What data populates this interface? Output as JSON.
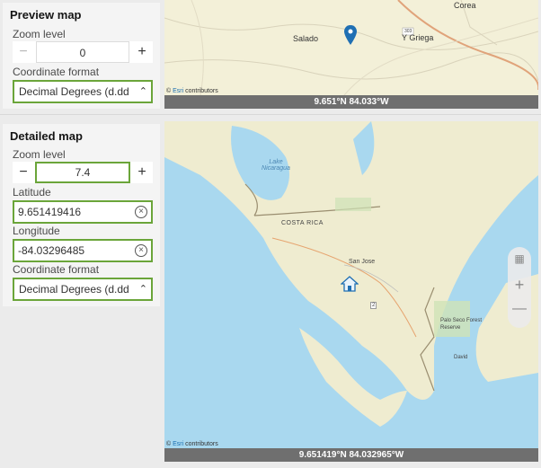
{
  "preview": {
    "title": "Preview map",
    "zoom_label": "Zoom level",
    "zoom_value": "0",
    "minus": "−",
    "plus": "+",
    "format_label": "Coordinate format",
    "format_value": "Decimal Degrees (d.dd",
    "coords": "9.651°N 84.033°W",
    "places": [
      "Corea",
      "Salado",
      "Y Griega",
      "303"
    ],
    "attribution_prefix": "©",
    "attribution_link": "Esri",
    "attribution_suffix": "contributors"
  },
  "detailed": {
    "title": "Detailed map",
    "zoom_label": "Zoom level",
    "zoom_value": "7.4",
    "minus": "−",
    "plus": "+",
    "lat_label": "Latitude",
    "lat_value": "9.651419416",
    "lon_label": "Longitude",
    "lon_value": "-84.03296485",
    "format_label": "Coordinate format",
    "format_value": "Decimal Degrees (d.dd",
    "coords": "9.651419°N 84.032965°W",
    "places": [
      "Lake Nicaragua",
      "COSTA RICA",
      "San Jose",
      "Palo Seco Forest Reserve",
      "David",
      "2"
    ],
    "map_zoom_in": "+",
    "map_zoom_out": "—",
    "attribution_prefix": "©",
    "attribution_link": "Esri",
    "attribution_suffix": "contributors"
  },
  "colors": {
    "highlight": "#6ba53a",
    "land": "#f3f0d8",
    "water": "#a9d8ef",
    "coordbar": "#6f6f6f",
    "pin": "#1f6fb3"
  },
  "icons": {
    "clear": "close-circle-icon",
    "chevron": "chevron-up-down-icon",
    "pin": "map-pin-icon",
    "home": "home-icon",
    "qr": "qr-code-icon"
  }
}
